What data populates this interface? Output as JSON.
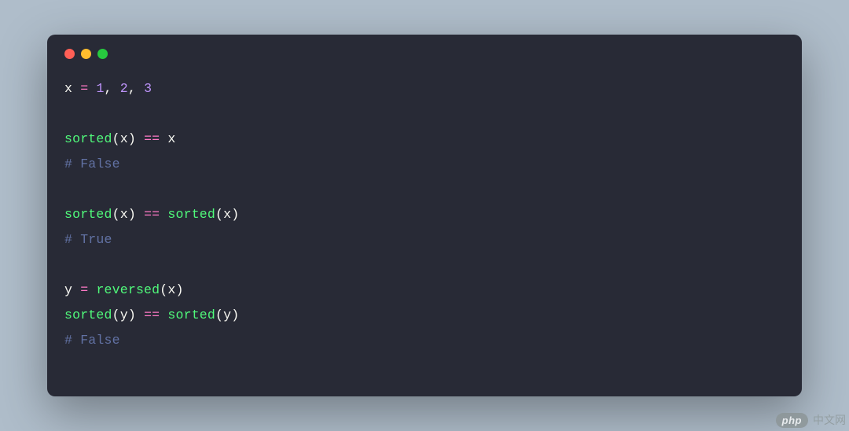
{
  "code": {
    "line1": {
      "var": "x",
      "sp": " ",
      "eq": "=",
      "sp2": " ",
      "n1": "1",
      "c1": ", ",
      "n2": "2",
      "c2": ", ",
      "n3": "3"
    },
    "line2": {
      "func": "sorted",
      "lp": "(",
      "arg": "x",
      "rp": ")",
      "sp": " ",
      "eqeq": "==",
      "sp2": " ",
      "rhs": "x"
    },
    "line3": {
      "comment": "# False"
    },
    "line4": {
      "func1": "sorted",
      "lp1": "(",
      "arg1": "x",
      "rp1": ")",
      "sp1": " ",
      "eqeq": "==",
      "sp2": " ",
      "func2": "sorted",
      "lp2": "(",
      "arg2": "x",
      "rp2": ")"
    },
    "line5": {
      "comment": "# True"
    },
    "line6": {
      "var": "y",
      "sp": " ",
      "eq": "=",
      "sp2": " ",
      "func": "reversed",
      "lp": "(",
      "arg": "x",
      "rp": ")"
    },
    "line7": {
      "func1": "sorted",
      "lp1": "(",
      "arg1": "y",
      "rp1": ")",
      "sp1": " ",
      "eqeq": "==",
      "sp2": " ",
      "func2": "sorted",
      "lp2": "(",
      "arg2": "y",
      "rp2": ")"
    },
    "line8": {
      "comment": "# False"
    }
  },
  "watermark": {
    "badge": "php",
    "text": "中文网"
  }
}
